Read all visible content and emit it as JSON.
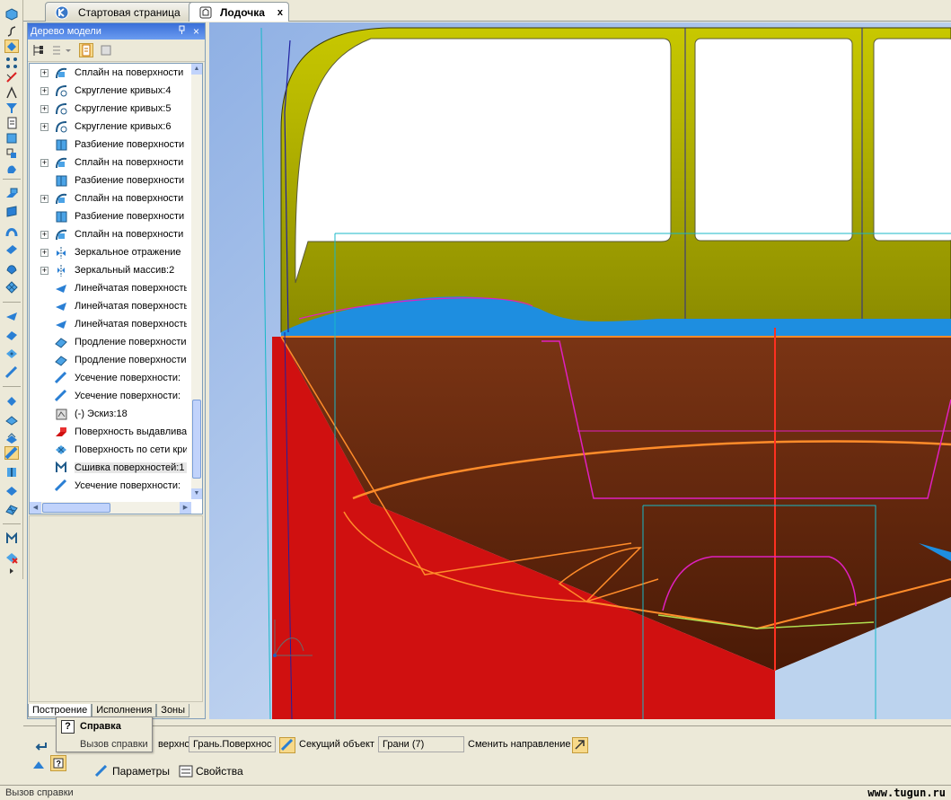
{
  "tabs": {
    "start_page": "Стартовая страница",
    "active_doc": "Лодочка",
    "close_glyph": "x"
  },
  "tree": {
    "title": "Дерево модели",
    "pin_glyph": " ᵩ",
    "close_glyph": "×",
    "items": [
      {
        "label": "Сплайн на поверхности",
        "expand": true,
        "icon": "spline-surface-icon"
      },
      {
        "label": "Скругление кривых:4",
        "expand": true,
        "icon": "curve-fillet-icon"
      },
      {
        "label": "Скругление кривых:5",
        "expand": true,
        "icon": "curve-fillet-icon"
      },
      {
        "label": "Скругление кривых:6",
        "expand": true,
        "icon": "curve-fillet-icon"
      },
      {
        "label": "Разбиение поверхности",
        "expand": false,
        "icon": "surface-split-icon"
      },
      {
        "label": "Сплайн на поверхности",
        "expand": true,
        "icon": "spline-surface-icon"
      },
      {
        "label": "Разбиение поверхности",
        "expand": false,
        "icon": "surface-split-icon"
      },
      {
        "label": "Сплайн на поверхности",
        "expand": true,
        "icon": "spline-surface-icon"
      },
      {
        "label": "Разбиение поверхности",
        "expand": false,
        "icon": "surface-split-icon"
      },
      {
        "label": "Сплайн на поверхности",
        "expand": true,
        "icon": "spline-surface-icon"
      },
      {
        "label": "Зеркальное отражение",
        "expand": true,
        "icon": "mirror-icon"
      },
      {
        "label": "Зеркальный массив:2",
        "expand": true,
        "icon": "mirror-array-icon"
      },
      {
        "label": "Линейчатая поверхность",
        "expand": false,
        "icon": "ruled-surface-icon"
      },
      {
        "label": "Линейчатая поверхность",
        "expand": false,
        "icon": "ruled-surface-icon"
      },
      {
        "label": "Линейчатая поверхность",
        "expand": false,
        "icon": "ruled-surface-icon"
      },
      {
        "label": "Продление поверхности",
        "expand": false,
        "icon": "extend-surface-icon"
      },
      {
        "label": "Продление поверхности",
        "expand": false,
        "icon": "extend-surface-icon"
      },
      {
        "label": "Усечение поверхности:",
        "expand": false,
        "icon": "trim-surface-icon"
      },
      {
        "label": "Усечение поверхности:",
        "expand": false,
        "icon": "trim-surface-icon"
      },
      {
        "label": "(-) Эскиз:18",
        "expand": false,
        "icon": "sketch-icon"
      },
      {
        "label": "Поверхность выдавливания",
        "expand": false,
        "icon": "extrude-surface-icon"
      },
      {
        "label": "Поверхность по сети кривых",
        "expand": false,
        "icon": "mesh-surface-icon"
      },
      {
        "label": "Сшивка поверхностей:1",
        "expand": false,
        "icon": "stitch-surface-icon",
        "selected": true
      },
      {
        "label": "Усечение поверхности:",
        "expand": false,
        "icon": "trim-surface-icon"
      }
    ],
    "bottom_tabs": [
      "Построение",
      "Исполнения",
      "Зоны"
    ]
  },
  "property_bar": {
    "surface_label": "верхность",
    "surface_value": "Грань.Поверхнос",
    "cutter_label": "Секущий объект",
    "cutter_value": "Грани (7)",
    "direction_label": "Сменить направление",
    "tabs": [
      "Параметры",
      "Свойства"
    ]
  },
  "tooltip": {
    "title": "Справка",
    "description": "Вызов справки",
    "icon_glyph": "?"
  },
  "status": {
    "text": "Вызов справки",
    "watermark": "www.tugun.ru"
  },
  "colors": {
    "hull_red": "#cc1414",
    "hull_brown": "#6b2a0e",
    "cabin_olive": "#9a9a00",
    "window_white": "#ffffff",
    "sky_blue": "#bcd3ee",
    "curve_orange": "#ff8c2a",
    "curve_magenta": "#e020c0"
  }
}
